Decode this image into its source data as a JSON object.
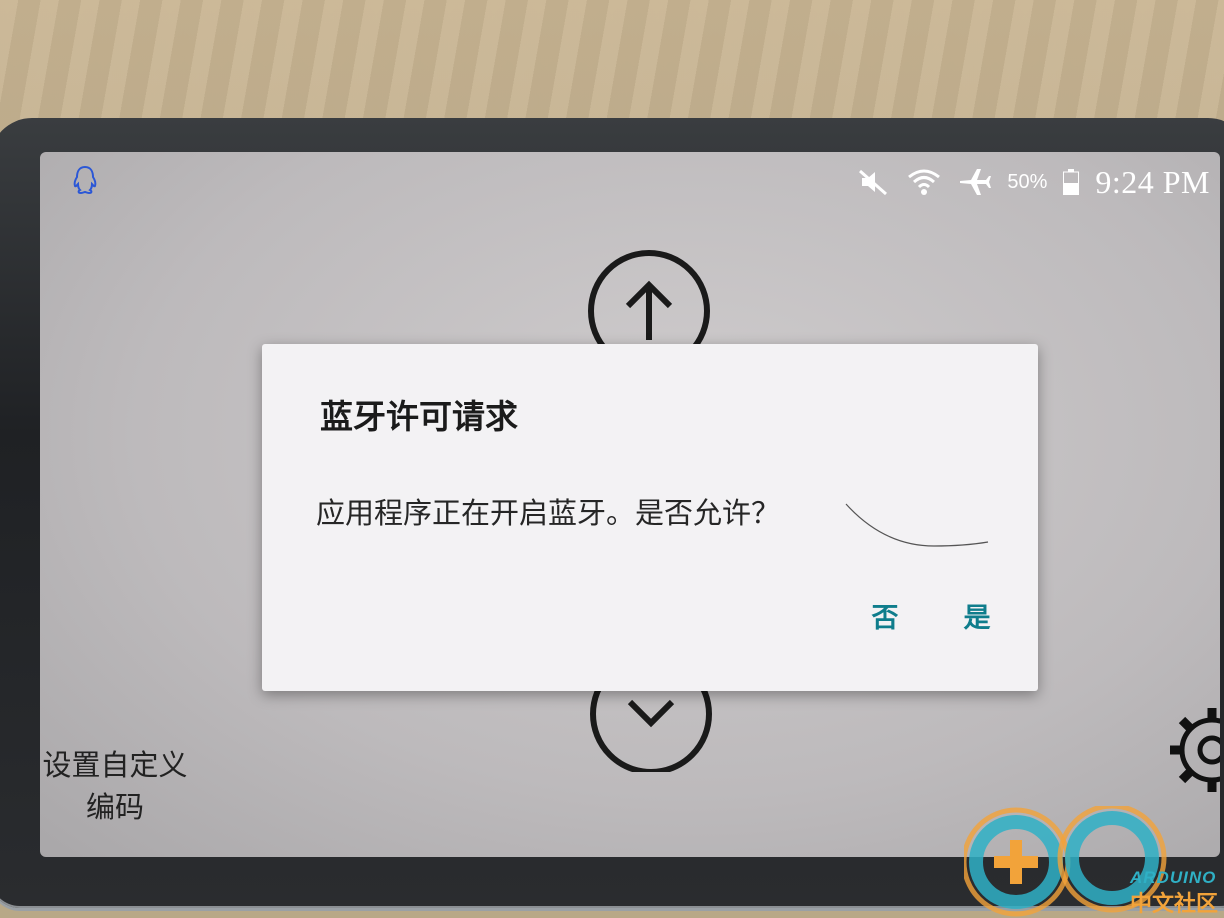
{
  "status_bar": {
    "app_notification_icon": "qq-penguin-icon",
    "icons": [
      "mute-icon",
      "wifi-icon",
      "airplane-mode-icon"
    ],
    "battery_percent": "50%",
    "battery_level": 0.5,
    "clock": "9:24 PM"
  },
  "app": {
    "up_arrow_icon": "arrow-up-icon",
    "down_arrow_icon": "arrow-down-icon",
    "custom_code_label_line1": "设置自定义",
    "custom_code_label_line2": "编码",
    "settings_icon": "gear-icon"
  },
  "dialog": {
    "title": "蓝牙许可请求",
    "message": "应用程序正在开启蓝牙。是否允许？",
    "buttons": {
      "no": "否",
      "yes": "是"
    },
    "accent_color": "#0f7d8c"
  },
  "watermark": {
    "text_en": "ARDUINO",
    "text_cn": "中文社区"
  }
}
